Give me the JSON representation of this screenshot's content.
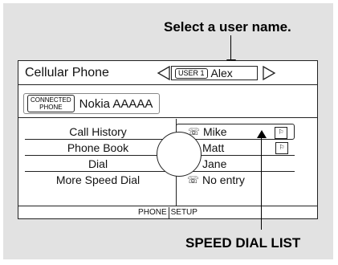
{
  "callouts": {
    "top": "Select a user name.",
    "bottom": "SPEED DIAL LIST"
  },
  "screen": {
    "title": "Cellular Phone",
    "user_tag": "USER 1",
    "user_name": "Alex",
    "connected_badge_line1": "CONNECTED",
    "connected_badge_line2": "PHONE",
    "phone_name": "Nokia AAAAA",
    "menu": [
      {
        "label": "Call History"
      },
      {
        "label": "Phone Book"
      },
      {
        "label": "Dial"
      },
      {
        "label": "More Speed Dial"
      }
    ],
    "speed_dial": [
      {
        "label": "Mike",
        "icon": "phone-icon",
        "has_voice_tag": true
      },
      {
        "label": "Matt",
        "icon": "phone-icon",
        "has_voice_tag": true
      },
      {
        "label": "Jane",
        "icon": "phone-icon",
        "has_voice_tag": false
      },
      {
        "label": "No entry",
        "icon": "phone-icon",
        "has_voice_tag": false
      }
    ],
    "bottom_left": "PHONE",
    "bottom_right": "SETUP"
  },
  "colors": {
    "panel_bg": "#e2e2e2",
    "screen_bg": "#ffffff",
    "line": "#222222"
  }
}
